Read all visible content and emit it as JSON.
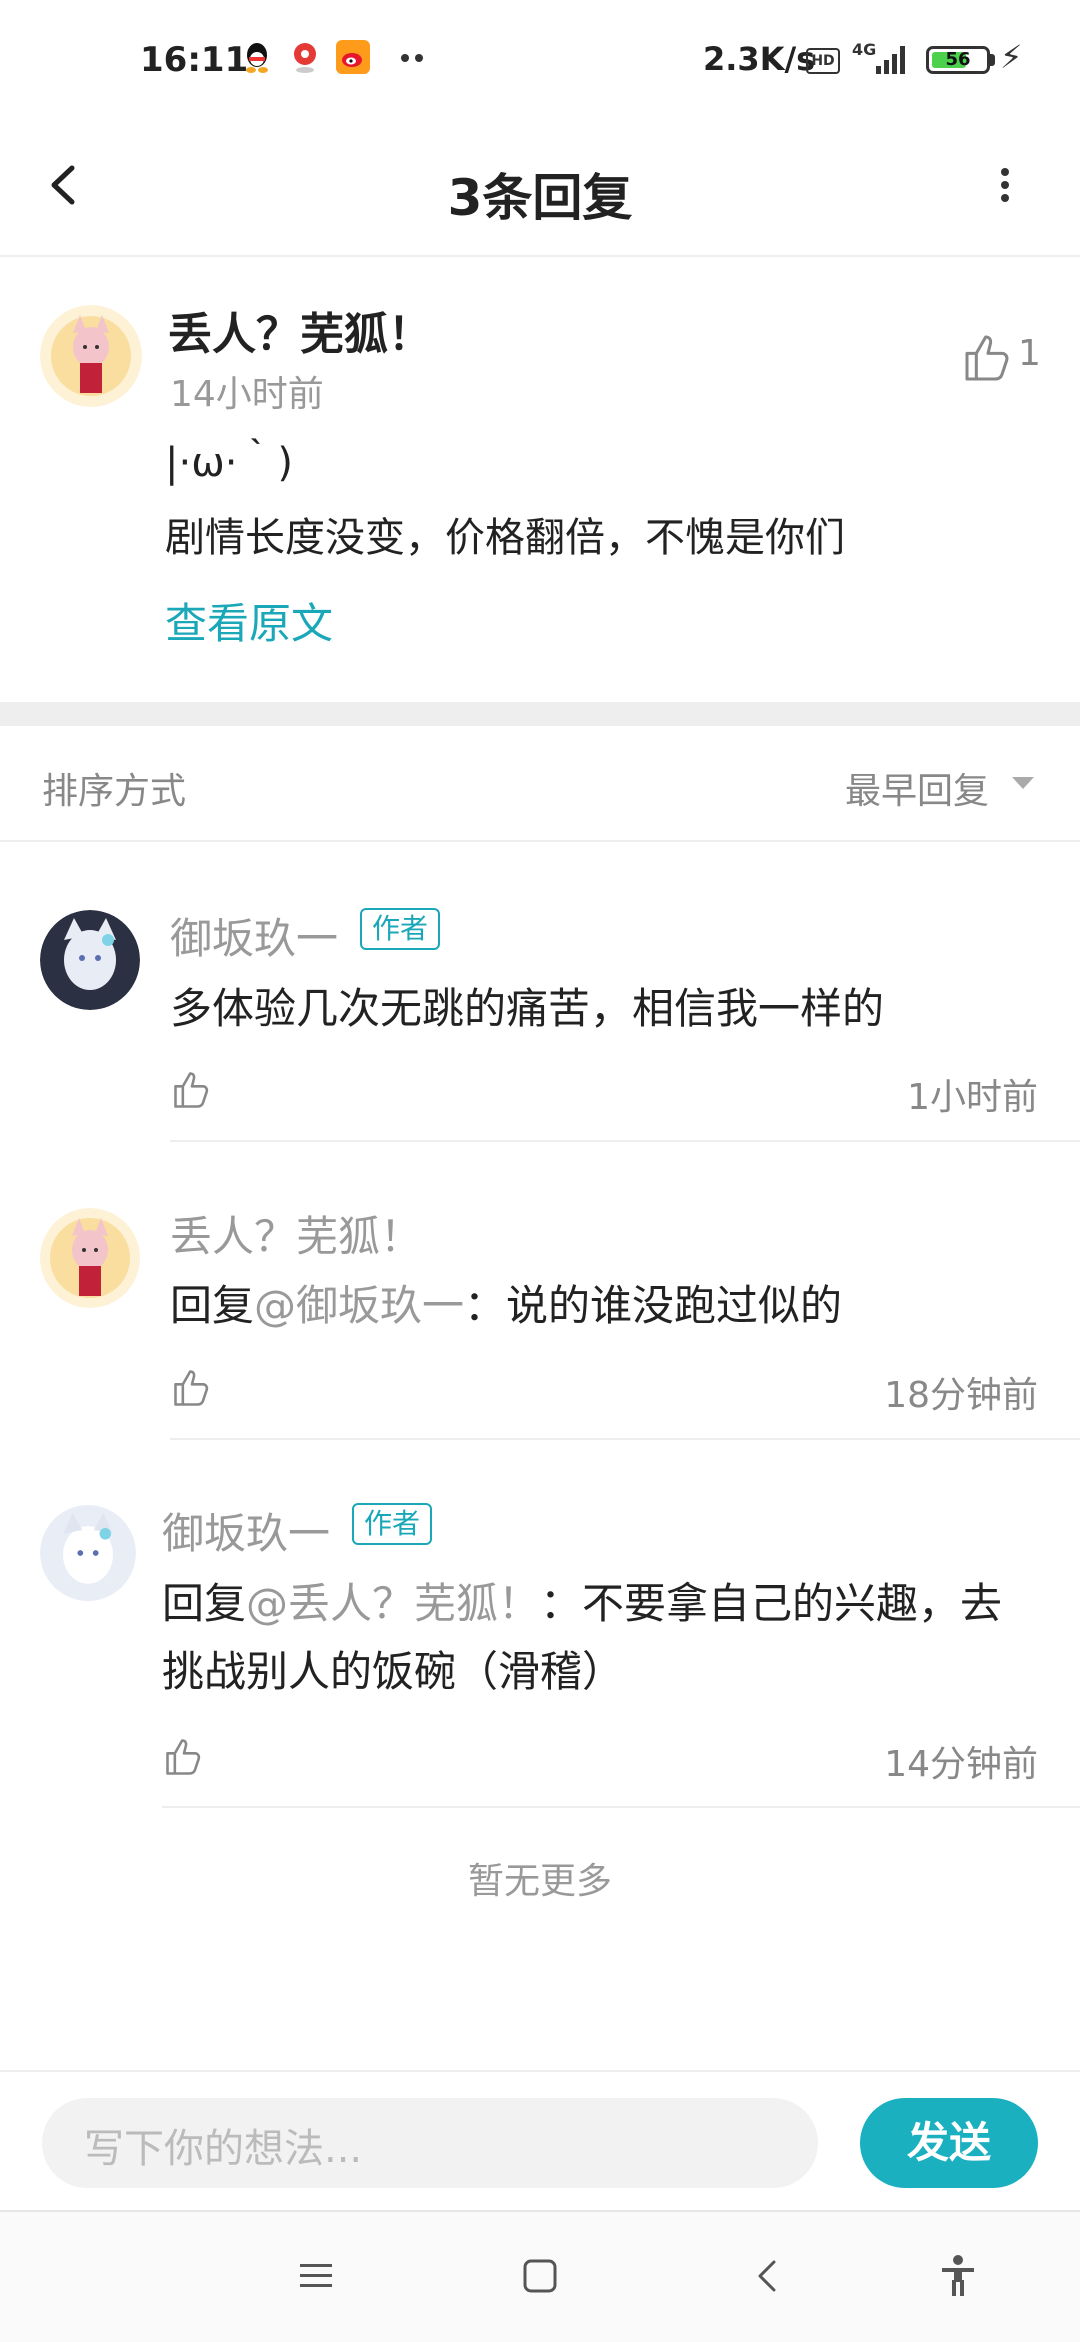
{
  "status_bar": {
    "time": "16:11",
    "network_speed": "2.3K/s",
    "hd_label": "HD",
    "signal_label": "4G",
    "battery_level": "56",
    "app_icons": [
      "qq-icon",
      "map-pin-icon",
      "weibo-icon"
    ]
  },
  "header": {
    "title": "3条回复"
  },
  "original": {
    "username": "丢人？芜狐！",
    "time": "14小时前",
    "like_count": "1",
    "line1": "|·ω·｀)",
    "line2": "剧情长度没变，价格翻倍，不愧是你们",
    "view_original": "查看原文"
  },
  "sort": {
    "label": "排序方式",
    "value": "最早回复"
  },
  "replies": [
    {
      "username": "御坂玖一",
      "tag": "作者",
      "text": "多体验几次无跳的痛苦，相信我一样的",
      "time": "1小时前"
    },
    {
      "username": "丢人？芜狐！",
      "reply_prefix": "回复",
      "reply_target": "@御坂玖一",
      "text": "：说的谁没跑过似的",
      "time": "18分钟前"
    },
    {
      "username": "御坂玖一",
      "tag": "作者",
      "reply_prefix": "回复",
      "reply_target": "@丢人？芜狐！",
      "text_line1": "：不要拿自己的兴趣，去",
      "text_line2": "挑战别人的饭碗（滑稽）",
      "time": "14分钟前"
    }
  ],
  "no_more": "暂无更多",
  "input": {
    "placeholder": "写下你的想法...",
    "send_label": "发送"
  },
  "colors": {
    "accent": "#1ab0c0",
    "tag": "#1aa7b8"
  }
}
